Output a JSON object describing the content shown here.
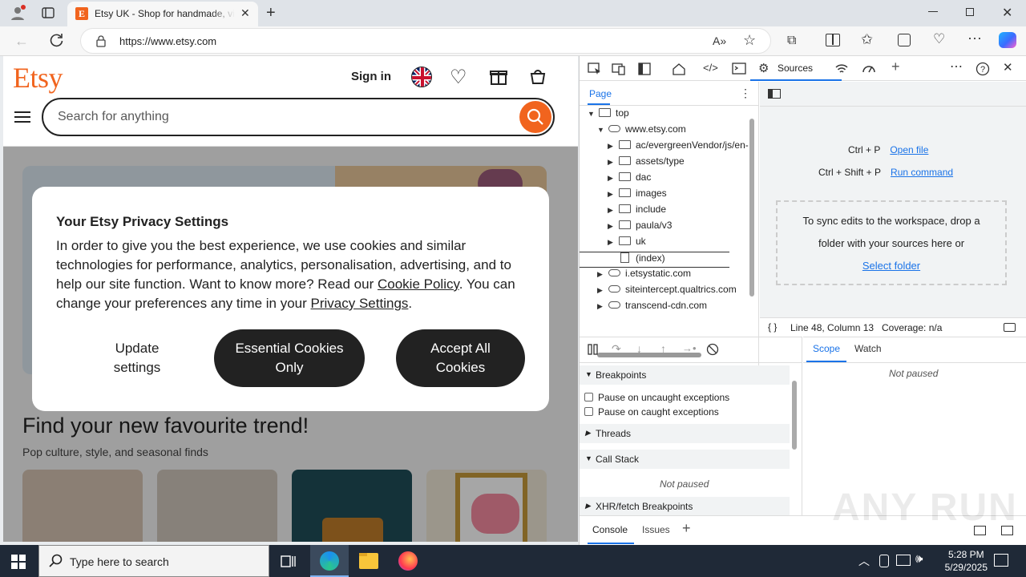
{
  "browser": {
    "tab_title": "Etsy UK - Shop for handmade, vintage",
    "url": "https://www.etsy.com"
  },
  "etsy": {
    "logo": "Etsy",
    "signin": "Sign in",
    "search_placeholder": "Search for anything",
    "trend_title": "Find your new favourite trend!",
    "trend_subtitle": "Pop culture, style, and seasonal finds"
  },
  "privacy_dialog": {
    "title": "Your Etsy Privacy Settings",
    "body_1": "In order to give you the best experience, we use cookies and similar technologies for performance, analytics, personalisation, advertising, and to help our site function. Want to know more? Read our ",
    "cookie_link": "Cookie Policy",
    "body_2": ". You can change your preferences any time in your ",
    "privacy_link": "Privacy Settings",
    "body_3": ".",
    "btn_update": "Update settings",
    "btn_essential": "Essential Cookies Only",
    "btn_accept": "Accept All Cookies"
  },
  "devtools": {
    "active_tab": "Sources",
    "nav_tab": "Page",
    "tree": [
      {
        "label": "top",
        "type": "frame",
        "arrow": "▼",
        "indent": 0
      },
      {
        "label": "www.etsy.com",
        "type": "cloud",
        "arrow": "▼",
        "indent": 1
      },
      {
        "label": "ac/evergreenVendor/js/en-",
        "type": "folder",
        "arrow": "▶",
        "indent": 2
      },
      {
        "label": "assets/type",
        "type": "folder",
        "arrow": "▶",
        "indent": 2
      },
      {
        "label": "dac",
        "type": "folder",
        "arrow": "▶",
        "indent": 2
      },
      {
        "label": "images",
        "type": "folder",
        "arrow": "▶",
        "indent": 2
      },
      {
        "label": "include",
        "type": "folder",
        "arrow": "▶",
        "indent": 2
      },
      {
        "label": "paula/v3",
        "type": "folder",
        "arrow": "▶",
        "indent": 2
      },
      {
        "label": "uk",
        "type": "folder",
        "arrow": "▶",
        "indent": 2
      },
      {
        "label": "(index)",
        "type": "file",
        "arrow": "",
        "indent": 2
      },
      {
        "label": "i.etsystatic.com",
        "type": "cloud",
        "arrow": "▶",
        "indent": 1
      },
      {
        "label": "siteintercept.qualtrics.com",
        "type": "cloud",
        "arrow": "▶",
        "indent": 1
      },
      {
        "label": "transcend-cdn.com",
        "type": "cloud",
        "arrow": "▶",
        "indent": 1
      }
    ],
    "shortcut_1_keys": "Ctrl + P",
    "shortcut_1_action": "Open file",
    "shortcut_2_keys": "Ctrl + Shift + P",
    "shortcut_2_action": "Run command",
    "drop_text": "To sync edits to the workspace, drop a folder with your sources here or",
    "drop_link": "Select folder",
    "status_braces": "{ }",
    "status_position": "Line 48, Column 13",
    "status_coverage": "Coverage: n/a",
    "breakpoints": "Breakpoints",
    "pause_uncaught": "Pause on uncaught exceptions",
    "pause_caught": "Pause on caught exceptions",
    "threads": "Threads",
    "call_stack": "Call Stack",
    "not_paused": "Not paused",
    "xhr": "XHR/fetch Breakpoints",
    "scope_tab": "Scope",
    "watch_tab": "Watch",
    "console_tab": "Console",
    "issues_tab": "Issues"
  },
  "taskbar": {
    "search_placeholder": "Type here to search",
    "time": "5:28 PM",
    "date": "5/29/2025"
  },
  "watermark": "ANY RUN",
  "colors": {
    "etsy_orange": "#f1641e",
    "devtools_blue": "#1a73e8",
    "dialog_button": "#222222"
  }
}
